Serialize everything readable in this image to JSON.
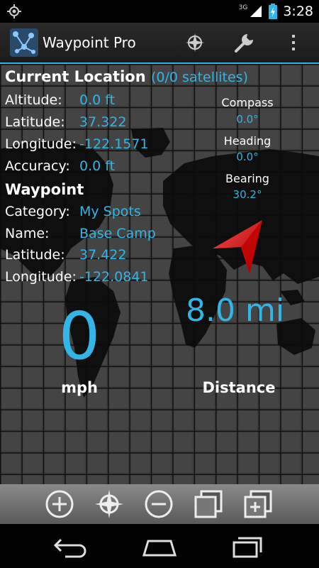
{
  "status_bar": {
    "network": "3G",
    "time": "3:28"
  },
  "action_bar": {
    "title": "Waypoint Pro",
    "icons": [
      "gps-lock-icon",
      "wrench-icon",
      "overflow-menu-icon"
    ]
  },
  "current_location": {
    "title": "Current Location",
    "satellites": "(0/0 satellites)",
    "altitude_label": "Altitude:",
    "altitude_value": "0.0  ft",
    "latitude_label": "Latitude:",
    "latitude_value": "37.322",
    "longitude_label": "Longitude:",
    "longitude_value": "-122.1571",
    "accuracy_label": "Accuracy:",
    "accuracy_value": "0.0  ft"
  },
  "waypoint": {
    "title": "Waypoint",
    "category_label": "Category:",
    "category_value": "My Spots",
    "name_label": "Name:",
    "name_value": "Base Camp",
    "latitude_label": "Latitude:",
    "latitude_value": "37.422",
    "longitude_label": "Longitude:",
    "longitude_value": "-122.0841"
  },
  "bearings": {
    "compass_label": "Compass",
    "compass_value": "0.0°",
    "heading_label": "Heading",
    "heading_value": "0.0°",
    "bearing_label": "Bearing",
    "bearing_value": "30.2°"
  },
  "speed": {
    "value": "0",
    "unit": "mph"
  },
  "distance": {
    "value": "8.0  mi",
    "label": "Distance"
  },
  "bottom_bar": {
    "icons": [
      "zoom-in-icon",
      "gps-lock-icon",
      "zoom-out-icon",
      "layers-icon",
      "add-layer-icon"
    ]
  },
  "colors": {
    "accent": "#33b5e5",
    "arrow": "#e00000",
    "grid_bg": "#3c3c3c"
  }
}
